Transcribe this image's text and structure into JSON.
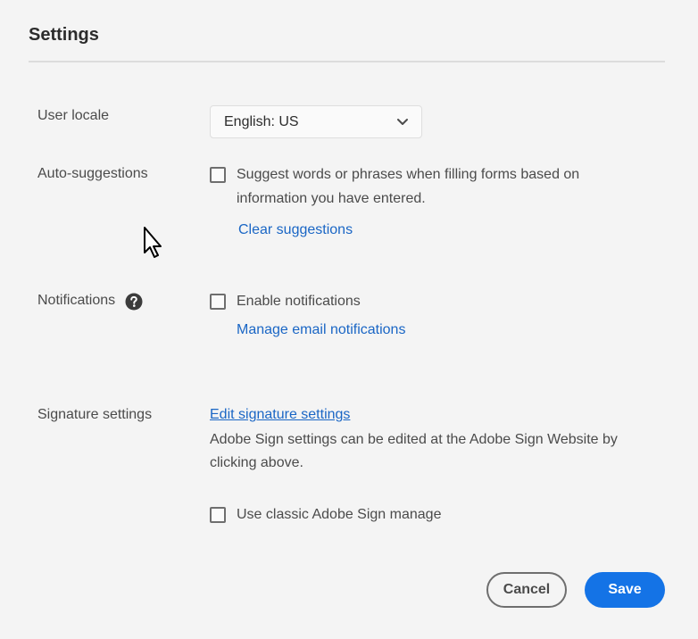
{
  "dialog": {
    "title": "Settings"
  },
  "user_locale": {
    "label": "User locale",
    "selected": "English: US"
  },
  "auto_suggestions": {
    "label": "Auto-suggestions",
    "checkbox_line1": "Suggest words or phrases when filling forms based on",
    "checkbox_line2": "information you have entered.",
    "checked": false,
    "clear_link": "Clear suggestions"
  },
  "notifications": {
    "label": "Notifications",
    "checkbox_label": "Enable notifications",
    "checked": false,
    "manage_link": "Manage email notifications"
  },
  "signature": {
    "label": "Signature settings",
    "edit_link": "Edit signature settings",
    "info_line1": "Adobe Sign settings can be edited at the Adobe Sign Website by",
    "info_line2": "clicking above.",
    "classic_checkbox_label": "Use classic Adobe Sign manage",
    "classic_checked": false
  },
  "footer": {
    "cancel_label": "Cancel",
    "save_label": "Save"
  },
  "colors": {
    "accent": "#1473e6",
    "link": "#1a66c5",
    "background": "#f4f4f4"
  }
}
